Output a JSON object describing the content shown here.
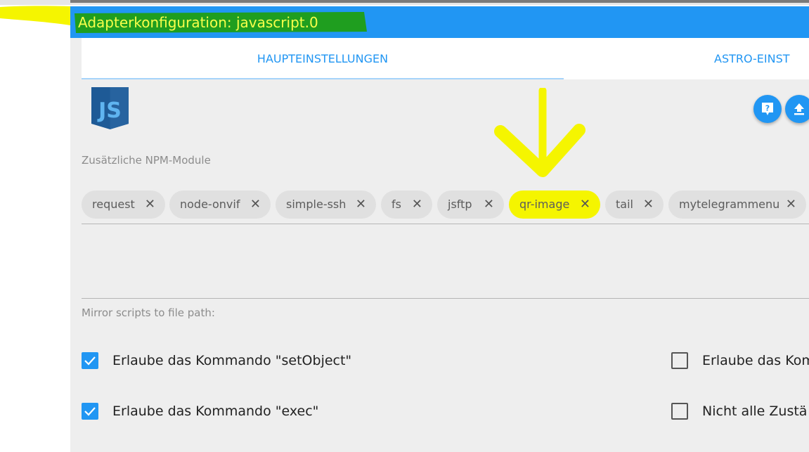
{
  "dialog": {
    "title": "Adapterkonfiguration: javascript.0",
    "tabs": [
      {
        "label": "HAUPTEINSTELLUNGEN",
        "active": true
      },
      {
        "label": "ASTRO-EINST"
      }
    ]
  },
  "logo": {
    "icon": "javascript-logo-icon",
    "text": "JS"
  },
  "actions": {
    "help_icon": "help-icon",
    "upload_icon": "upload-icon"
  },
  "npm_modules": {
    "label": "Zusätzliche NPM-Module",
    "chips": [
      "request",
      "node-onvif",
      "simple-ssh",
      "fs",
      "jsftp",
      "qr-image",
      "tail",
      "mytelegrammenu"
    ],
    "remove_glyph": "✕"
  },
  "mirror": {
    "label": "Mirror scripts to file path:",
    "value": ""
  },
  "options": [
    {
      "label": "Erlaube das Kommando \"setObject\"",
      "checked": true
    },
    {
      "label": "Erlaube das Kom",
      "checked": false
    },
    {
      "label": "Erlaube das Kommando \"exec\"",
      "checked": true
    },
    {
      "label": "Nicht alle Zustä",
      "checked": false
    }
  ],
  "colors": {
    "accent": "#2196f3",
    "background": "#eeeeee",
    "chip": "#e0e0e0",
    "highlight_yellow": "#f5f500",
    "highlight_green": "#1f9e1f"
  }
}
